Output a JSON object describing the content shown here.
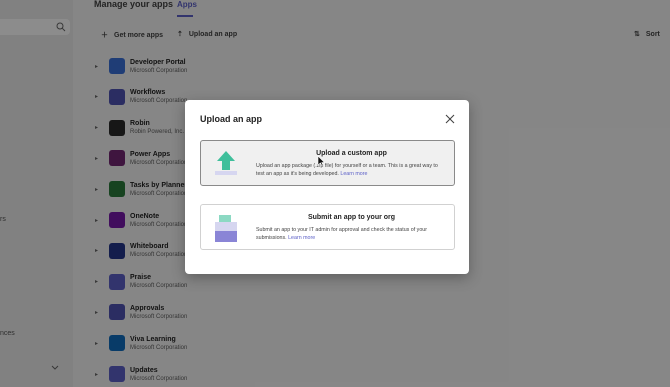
{
  "sidebar": {
    "text_1": "rs",
    "text_2": "nces"
  },
  "header": {
    "title": "Manage your apps",
    "tab": "Apps"
  },
  "toolbar": {
    "get_more": "Get more apps",
    "upload": "Upload an app",
    "sort": "Sort"
  },
  "apps": [
    {
      "name": "Developer Portal",
      "publisher": "Microsoft Corporation",
      "color": "#3a6fd8"
    },
    {
      "name": "Workflows",
      "publisher": "Microsoft Corporation",
      "color": "#4f52b2"
    },
    {
      "name": "Robin",
      "publisher": "Robin Powered, Inc.",
      "color": "#2b2b2b"
    },
    {
      "name": "Power Apps",
      "publisher": "Microsoft Corporation",
      "color": "#742774"
    },
    {
      "name": "Tasks by Planner and To Do",
      "publisher": "Microsoft Corporation",
      "color": "#2a7a3b"
    },
    {
      "name": "OneNote",
      "publisher": "Microsoft Corporation",
      "color": "#7719aa"
    },
    {
      "name": "Whiteboard",
      "publisher": "Microsoft Corporation",
      "color": "#24368a"
    },
    {
      "name": "Praise",
      "publisher": "Microsoft Corporation",
      "color": "#5b5fc7"
    },
    {
      "name": "Approvals",
      "publisher": "Microsoft Corporation",
      "color": "#4f52b2"
    },
    {
      "name": "Viva Learning",
      "publisher": "Microsoft Corporation",
      "color": "#0f6cbd"
    },
    {
      "name": "Updates",
      "publisher": "Microsoft Corporation",
      "color": "#5b5fc7"
    }
  ],
  "dialog": {
    "title": "Upload an app",
    "close_label": "Close",
    "option1": {
      "title": "Upload a custom app",
      "desc": "Upload an app package (.zip file) for yourself or a team. This is a great way to test an app as it's being developed.",
      "link": "Learn more"
    },
    "option2": {
      "title": "Submit an app to your org",
      "desc": "Submit an app to your IT admin for approval and check the status of your submissions.",
      "link": "Learn more"
    }
  },
  "colors": {
    "accent": "#5b5fc7",
    "upload_icon": "#3fbf9b",
    "submit_icon": "#8a85d6"
  }
}
